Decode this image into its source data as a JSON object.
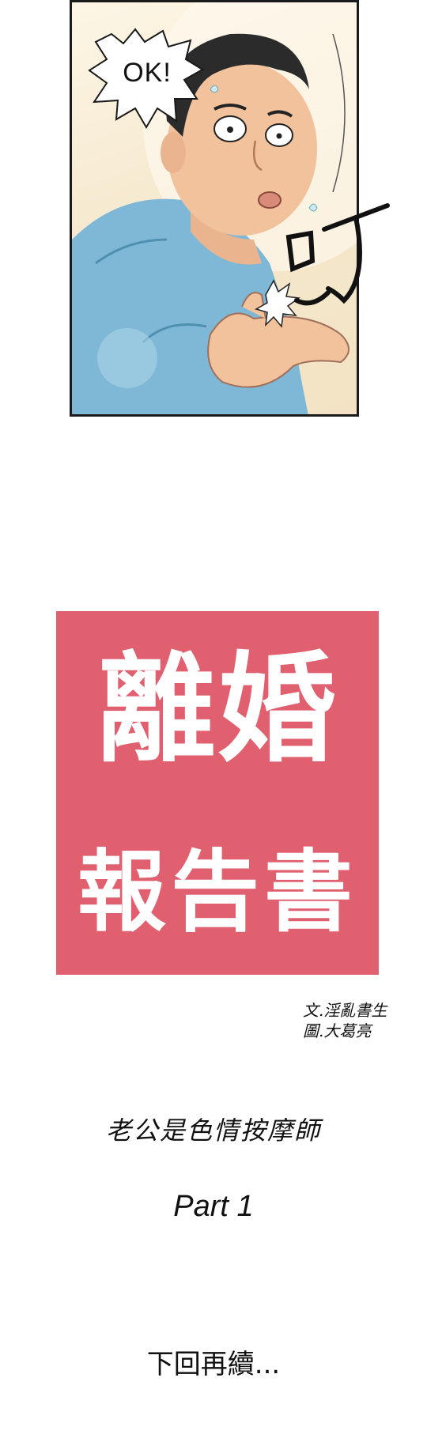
{
  "comic_panel": {
    "speech_bubble_text": "OK!",
    "sound_effect_text": "咑"
  },
  "title_card": {
    "line1": "離婚",
    "line2": "報告書",
    "background_color": "#e06070",
    "text_color": "#ffffff"
  },
  "credits": {
    "writer": "文.淫亂書生",
    "artist": "圖.大葛亮"
  },
  "episode": {
    "subtitle": "老公是色情按摩師",
    "part": "Part 1"
  },
  "footer": {
    "to_be_continued": "下回再續..."
  }
}
